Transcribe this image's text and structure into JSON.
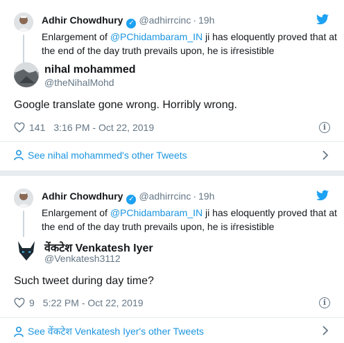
{
  "tweets": [
    {
      "quoted": {
        "name": "Adhir Chowdhury",
        "handle": "@adhirrcinc",
        "time": "19h",
        "text_before": "Enlargement of ",
        "mention": "@PChidambaram_IN",
        "text_after": " ji has eloquently proved that at the end of the day truth prevails upon, he is iŕresistible"
      },
      "reply": {
        "name": "nihal mohammed",
        "handle": "@theNihalMohd",
        "text": "Google translate gone wrong. Horribly wrong.",
        "likes": "141",
        "timestamp": "3:16 PM - Oct 22, 2019",
        "see_more": "See nihal mohammed's other Tweets"
      }
    },
    {
      "quoted": {
        "name": "Adhir Chowdhury",
        "handle": "@adhirrcinc",
        "time": "19h",
        "text_before": "Enlargement of ",
        "mention": "@PChidambaram_IN",
        "text_after": " ji has eloquently proved that at the end of the day truth prevails upon, he is iŕresistible"
      },
      "reply": {
        "name": "वेंकटेश Venkatesh Iyer",
        "handle": "@Venkatesh3112",
        "text": "Such tweet during day time?",
        "likes": "9",
        "timestamp": "5:22 PM - Oct 22, 2019",
        "see_more": "See वेंकटेश Venkatesh Iyer's other Tweets"
      }
    }
  ],
  "colors": {
    "link": "#1b95e0",
    "secondary_text": "#657786",
    "verified": "#1da1f2",
    "background": "#e6ecf0"
  },
  "icons": [
    "verified-badge-icon",
    "twitter-bird-icon",
    "heart-icon",
    "info-icon",
    "person-icon",
    "chevron-right-icon"
  ]
}
